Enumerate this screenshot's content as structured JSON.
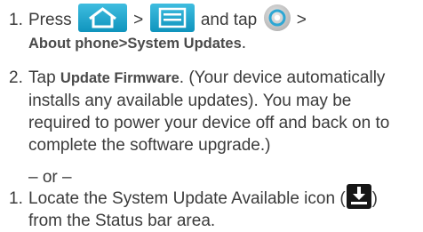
{
  "steps_a": {
    "step1": {
      "number": "1.",
      "press": "Press",
      "sep1": ">",
      "and_tap": "and tap",
      "sep2": ">",
      "path_part1": "About phone",
      "path_sep": ">",
      "path_part2": "System Updates",
      "path_end": "."
    },
    "step2": {
      "number": "2.",
      "tap": "Tap",
      "action": "Update Firmware",
      "line1_rest": ". (Your device automatically",
      "line2": "installs any available updates). You may be",
      "line3": "required to power your device off and back on to",
      "line4": "complete the software upgrade.)"
    }
  },
  "or_text": "– or –",
  "steps_b": {
    "step1": {
      "number": "1.",
      "line1_text": "Locate the System Update Available icon (",
      "line1_close": ")",
      "line2": "from the Status bar area."
    }
  },
  "icons": {
    "home": "home-icon",
    "menu": "menu-icon",
    "settings": "settings-icon",
    "update_available": "system-update-download-icon"
  },
  "colors": {
    "button_gradient_top": "#3fbde0",
    "button_gradient_bottom": "#0f94bd",
    "text": "#3b3b3b"
  }
}
